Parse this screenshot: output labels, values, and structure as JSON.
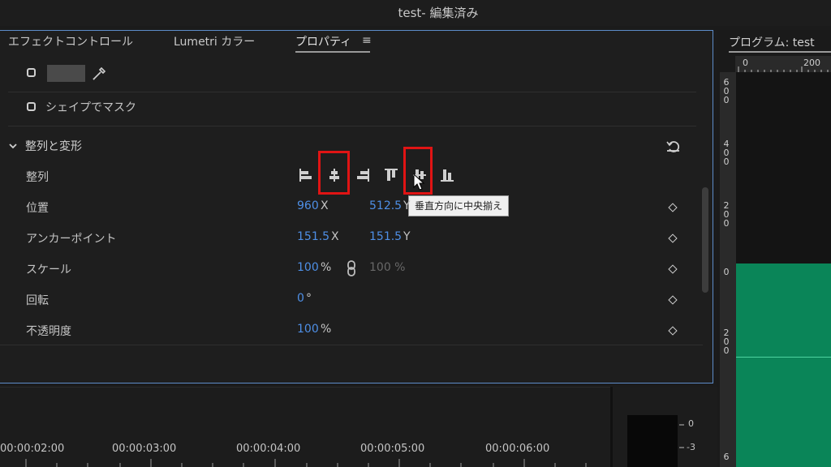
{
  "window": {
    "title": "test- 編集済み"
  },
  "tabs": [
    {
      "label": "エフェクトコントロール"
    },
    {
      "label": "Lumetri カラー"
    },
    {
      "label": "プロパティ"
    }
  ],
  "mask": {
    "label": "シェイプでマスク"
  },
  "section": {
    "label": "整列と変形"
  },
  "props": {
    "align_label": "整列",
    "position": {
      "label": "位置",
      "x": "960",
      "x_unit": "X",
      "y": "512.5",
      "y_unit": "Y"
    },
    "anchor": {
      "label": "アンカーポイント",
      "x": "151.5",
      "x_unit": "X",
      "y": "151.5",
      "y_unit": "Y"
    },
    "scale": {
      "label": "スケール",
      "value": "100",
      "unit": "%",
      "linked": "100 %"
    },
    "rotation": {
      "label": "回転",
      "value": "0",
      "unit": "°"
    },
    "opacity": {
      "label": "不透明度",
      "value": "100",
      "unit": "%"
    }
  },
  "tooltip": {
    "text": "垂直方向に中央揃え"
  },
  "program": {
    "title": "プログラム: test",
    "ruler_h": [
      "0",
      "200"
    ],
    "ruler_v": [
      "600",
      "400",
      "200",
      "0",
      "200",
      "6"
    ]
  },
  "timeline": {
    "timecodes": [
      "00:00:02:00",
      "00:00:03:00",
      "00:00:04:00",
      "00:00:05:00",
      "00:00:06:00"
    ]
  },
  "meter": {
    "marks": [
      "0",
      "-3"
    ]
  },
  "colors": {
    "accent_blue": "#4e8fe6",
    "panel_border": "#5d8cc9",
    "highlight_red": "#e01414",
    "canvas_green": "#0a8558"
  }
}
